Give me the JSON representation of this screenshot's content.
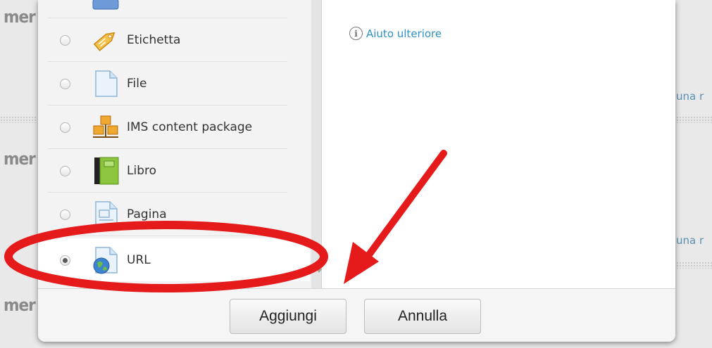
{
  "background": {
    "left_fragments": [
      "mer",
      "mer",
      "mer"
    ],
    "right_fragments": [
      "una r",
      "una r"
    ]
  },
  "modal": {
    "options": [
      {
        "label": "Etichetta",
        "icon": "label-tag-icon",
        "selected": false
      },
      {
        "label": "File",
        "icon": "file-icon",
        "selected": false
      },
      {
        "label": "IMS content package",
        "icon": "ims-package-icon",
        "selected": false
      },
      {
        "label": "Libro",
        "icon": "book-icon",
        "selected": false
      },
      {
        "label": "Pagina",
        "icon": "page-icon",
        "selected": false
      },
      {
        "label": "URL",
        "icon": "url-globe-icon",
        "selected": true
      }
    ],
    "help_link": "Aiuto ulteriore",
    "buttons": {
      "add": "Aggiungi",
      "cancel": "Annulla"
    }
  },
  "annotation_color": "#e51b1b"
}
